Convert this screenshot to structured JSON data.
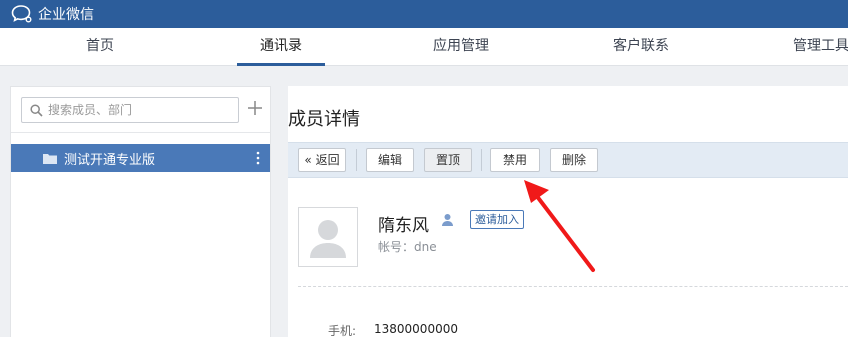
{
  "app": {
    "title": "企业微信",
    "logo_icon": "chat-bubble-icon"
  },
  "nav": {
    "tabs": [
      {
        "label": "首页"
      },
      {
        "label": "通讯录",
        "active": true
      },
      {
        "label": "应用管理"
      },
      {
        "label": "客户联系"
      },
      {
        "label": "管理工具"
      }
    ]
  },
  "sidebar": {
    "search": {
      "placeholder": "搜索成员、部门",
      "value": ""
    },
    "departments": [
      {
        "label": "测试开通专业版",
        "selected": true
      }
    ]
  },
  "detail": {
    "title": "成员详情",
    "toolbar": {
      "back_label": "返回",
      "back_glyph": "«",
      "edit_label": "编辑",
      "pin_label": "置顶",
      "disable_label": "禁用",
      "delete_label": "删除"
    },
    "member": {
      "name": "隋东风",
      "invite_label": "邀请加入",
      "account": "帐号：dne"
    },
    "fields": [
      {
        "label": "手机:",
        "value": "13800000000"
      }
    ]
  },
  "colors": {
    "brand": "#2c5d9b",
    "selected": "#4a79b8",
    "toolbar_bg": "#e3ebf4",
    "annotation_arrow": "#f01919"
  }
}
